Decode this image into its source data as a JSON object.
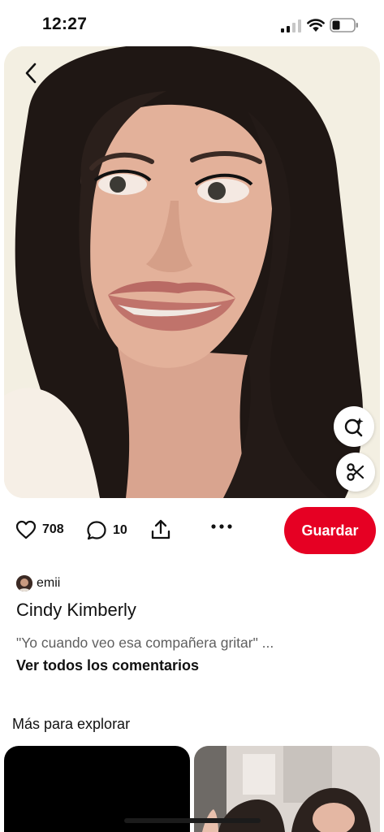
{
  "status_bar": {
    "time": "12:27"
  },
  "pin": {
    "image_alt": "",
    "likes": "708",
    "comments": "10",
    "save_label": "Guardar",
    "author": "emii",
    "title": "Cindy Kimberly",
    "description": "\"Yo cuando veo esa compañera gritar\" ...",
    "view_comments": "Ver todos los comentarios"
  },
  "explore": {
    "heading": "Más para explorar"
  },
  "icons": {
    "back": "chevron-left-icon",
    "visual_search": "lens-search-icon",
    "cutout": "scissors-icon",
    "like": "heart-icon",
    "comment": "comment-bubble-icon",
    "share": "share-icon",
    "more": "more-dots-icon"
  },
  "colors": {
    "accent": "#e60023",
    "text_primary": "#111111",
    "text_secondary": "#5f5f5f"
  }
}
